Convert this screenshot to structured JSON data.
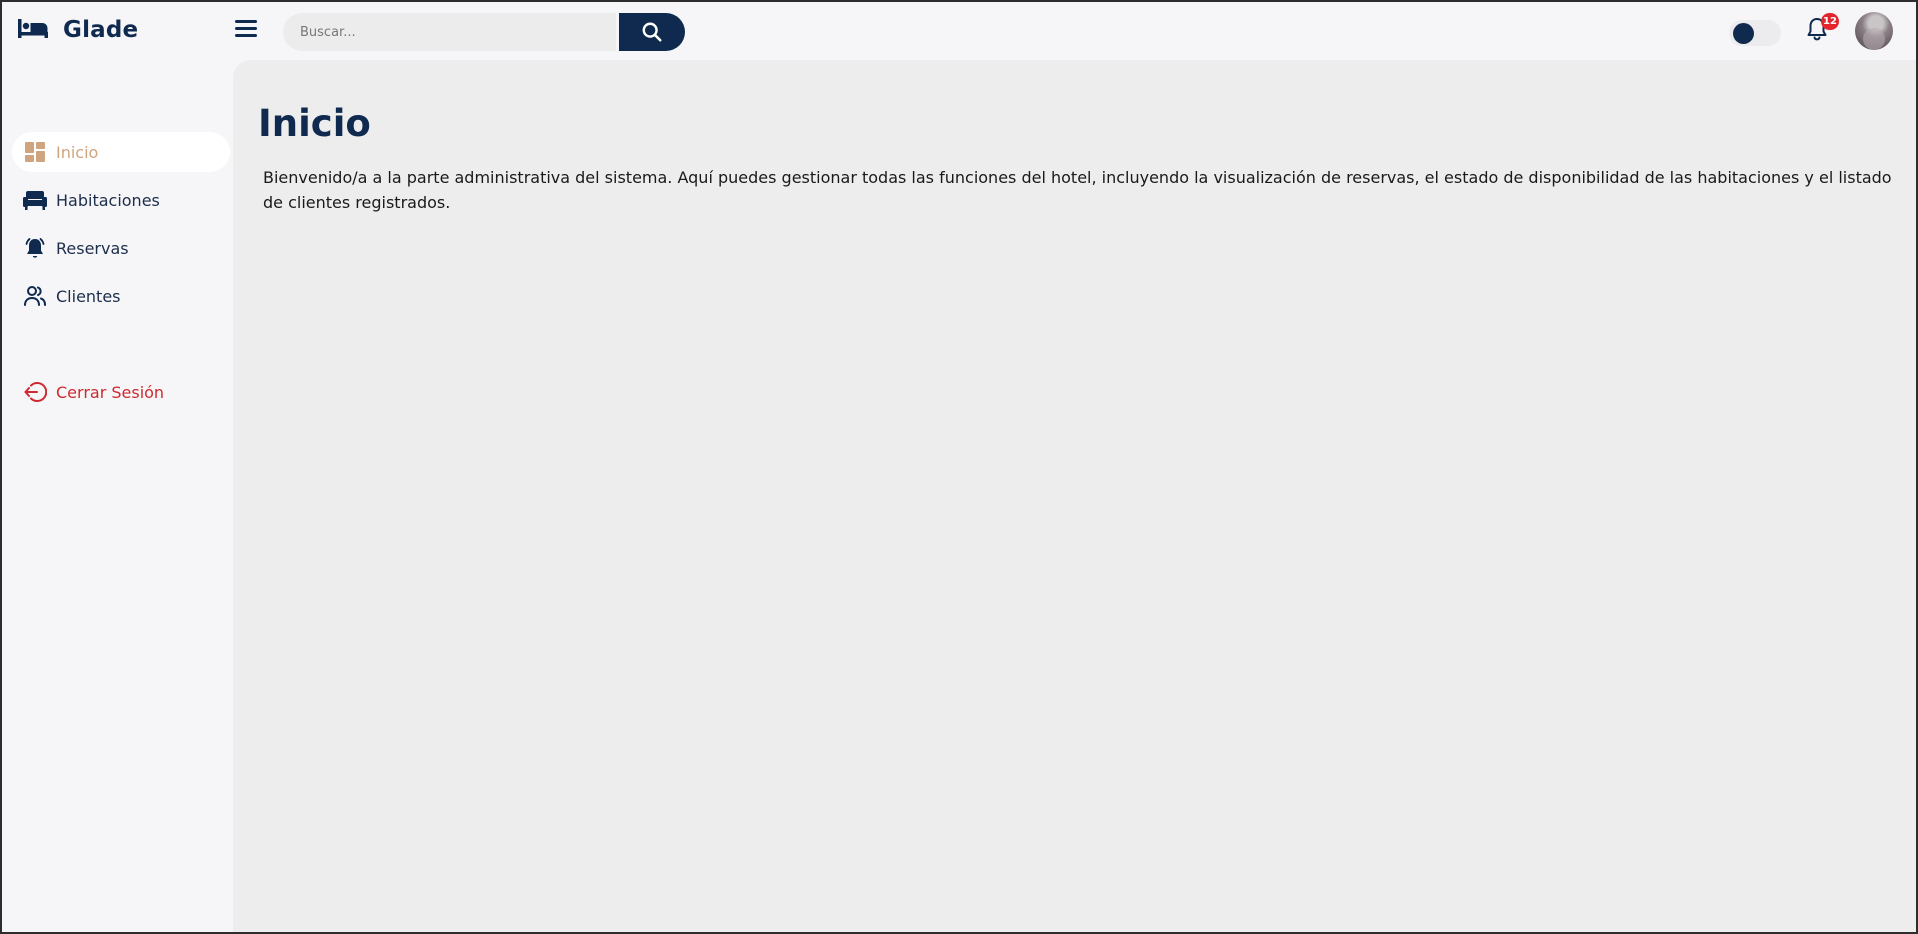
{
  "brand": {
    "name": "Glade",
    "icon": "bed-icon"
  },
  "search": {
    "placeholder": "Buscar..."
  },
  "notifications": {
    "count": "12"
  },
  "theme_toggle": {
    "state": "dark"
  },
  "sidebar": {
    "items": [
      {
        "label": "Inicio",
        "icon": "dashboard-icon",
        "active": true
      },
      {
        "label": "Habitaciones",
        "icon": "sofa-icon"
      },
      {
        "label": "Reservas",
        "icon": "bell-ringing-icon"
      },
      {
        "label": "Clientes",
        "icon": "users-icon"
      }
    ],
    "logout": {
      "label": "Cerrar Sesión",
      "icon": "logout-icon"
    }
  },
  "main": {
    "title": "Inicio",
    "description": "Bienvenido/a a la parte administrativa del sistema. Aquí puedes gestionar todas las funciones del hotel, incluyendo la visualización de reservas, el estado de disponibilidad de las habitaciones y el listado de clientes registrados."
  },
  "colors": {
    "primary": "#0f2a4e",
    "accent": "#cfa57f",
    "danger": "#cc2a2f",
    "badge": "#e3262d"
  }
}
